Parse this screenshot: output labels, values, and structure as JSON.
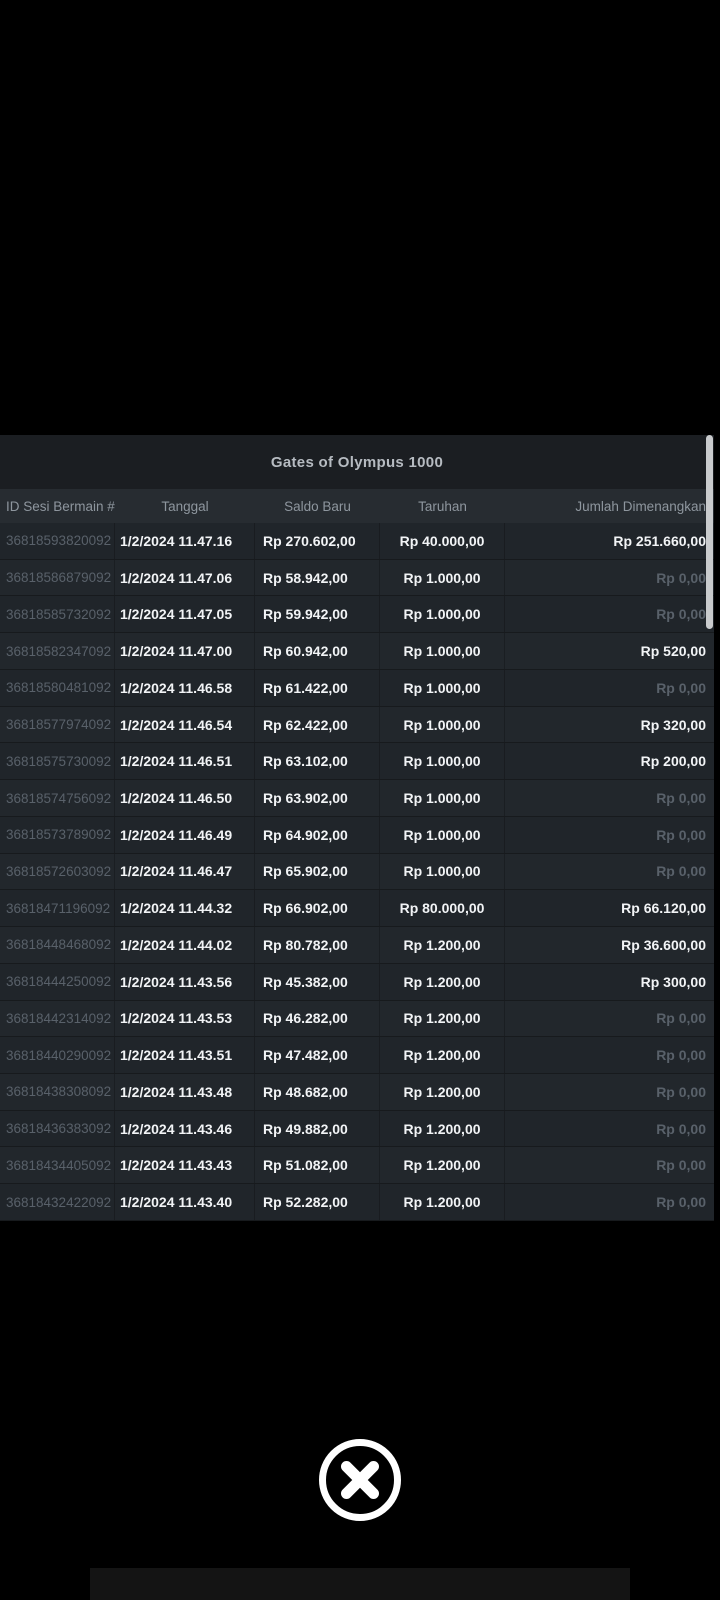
{
  "modal": {
    "title": "Gates of Olympus 1000",
    "columns": [
      {
        "label": "ID Sesi Bermain #"
      },
      {
        "label": "Tanggal"
      },
      {
        "label": "Saldo Baru"
      },
      {
        "label": "Taruhan"
      },
      {
        "label": "Jumlah Dimenangkan"
      }
    ],
    "rows": [
      {
        "id": "36818593820092",
        "date": "1/2/2024 11.47.16",
        "balance": "Rp 270.602,00",
        "bet": "Rp 40.000,00",
        "win": "Rp 251.660,00",
        "win_dim": false
      },
      {
        "id": "36818586879092",
        "date": "1/2/2024 11.47.06",
        "balance": "Rp 58.942,00",
        "bet": "Rp 1.000,00",
        "win": "Rp 0,00",
        "win_dim": true
      },
      {
        "id": "36818585732092",
        "date": "1/2/2024 11.47.05",
        "balance": "Rp 59.942,00",
        "bet": "Rp 1.000,00",
        "win": "Rp 0,00",
        "win_dim": true
      },
      {
        "id": "36818582347092",
        "date": "1/2/2024 11.47.00",
        "balance": "Rp 60.942,00",
        "bet": "Rp 1.000,00",
        "win": "Rp 520,00",
        "win_dim": false
      },
      {
        "id": "36818580481092",
        "date": "1/2/2024 11.46.58",
        "balance": "Rp 61.422,00",
        "bet": "Rp 1.000,00",
        "win": "Rp 0,00",
        "win_dim": true
      },
      {
        "id": "36818577974092",
        "date": "1/2/2024 11.46.54",
        "balance": "Rp 62.422,00",
        "bet": "Rp 1.000,00",
        "win": "Rp 320,00",
        "win_dim": false
      },
      {
        "id": "36818575730092",
        "date": "1/2/2024 11.46.51",
        "balance": "Rp 63.102,00",
        "bet": "Rp 1.000,00",
        "win": "Rp 200,00",
        "win_dim": false
      },
      {
        "id": "36818574756092",
        "date": "1/2/2024 11.46.50",
        "balance": "Rp 63.902,00",
        "bet": "Rp 1.000,00",
        "win": "Rp 0,00",
        "win_dim": true
      },
      {
        "id": "36818573789092",
        "date": "1/2/2024 11.46.49",
        "balance": "Rp 64.902,00",
        "bet": "Rp 1.000,00",
        "win": "Rp 0,00",
        "win_dim": true
      },
      {
        "id": "36818572603092",
        "date": "1/2/2024 11.46.47",
        "balance": "Rp 65.902,00",
        "bet": "Rp 1.000,00",
        "win": "Rp 0,00",
        "win_dim": true
      },
      {
        "id": "36818471196092",
        "date": "1/2/2024 11.44.32",
        "balance": "Rp 66.902,00",
        "bet": "Rp 80.000,00",
        "win": "Rp 66.120,00",
        "win_dim": false
      },
      {
        "id": "36818448468092",
        "date": "1/2/2024 11.44.02",
        "balance": "Rp 80.782,00",
        "bet": "Rp 1.200,00",
        "win": "Rp 36.600,00",
        "win_dim": false
      },
      {
        "id": "36818444250092",
        "date": "1/2/2024 11.43.56",
        "balance": "Rp 45.382,00",
        "bet": "Rp 1.200,00",
        "win": "Rp 300,00",
        "win_dim": false
      },
      {
        "id": "36818442314092",
        "date": "1/2/2024 11.43.53",
        "balance": "Rp 46.282,00",
        "bet": "Rp 1.200,00",
        "win": "Rp 0,00",
        "win_dim": true
      },
      {
        "id": "36818440290092",
        "date": "1/2/2024 11.43.51",
        "balance": "Rp 47.482,00",
        "bet": "Rp 1.200,00",
        "win": "Rp 0,00",
        "win_dim": true
      },
      {
        "id": "36818438308092",
        "date": "1/2/2024 11.43.48",
        "balance": "Rp 48.682,00",
        "bet": "Rp 1.200,00",
        "win": "Rp 0,00",
        "win_dim": true
      },
      {
        "id": "36818436383092",
        "date": "1/2/2024 11.43.46",
        "balance": "Rp 49.882,00",
        "bet": "Rp 1.200,00",
        "win": "Rp 0,00",
        "win_dim": true
      },
      {
        "id": "36818434405092",
        "date": "1/2/2024 11.43.43",
        "balance": "Rp 51.082,00",
        "bet": "Rp 1.200,00",
        "win": "Rp 0,00",
        "win_dim": true
      },
      {
        "id": "36818432422092",
        "date": "1/2/2024 11.43.40",
        "balance": "Rp 52.282,00",
        "bet": "Rp 1.200,00",
        "win": "Rp 0,00",
        "win_dim": true
      }
    ]
  },
  "close_button": {
    "icon": "close-circle-icon"
  },
  "colors": {
    "background": "#000000",
    "title_bar_bg": "#1b1e22",
    "header_bg": "#272c31",
    "row_bg_odd": "#20252a",
    "row_bg_even": "#22272c",
    "title_text": "#b6bbc1",
    "header_text": "#8e969e",
    "muted_text": "#59616a",
    "value_text": "#f2f4f6",
    "scrollbar": "#c9cbcd",
    "close_icon": "#ffffff"
  }
}
